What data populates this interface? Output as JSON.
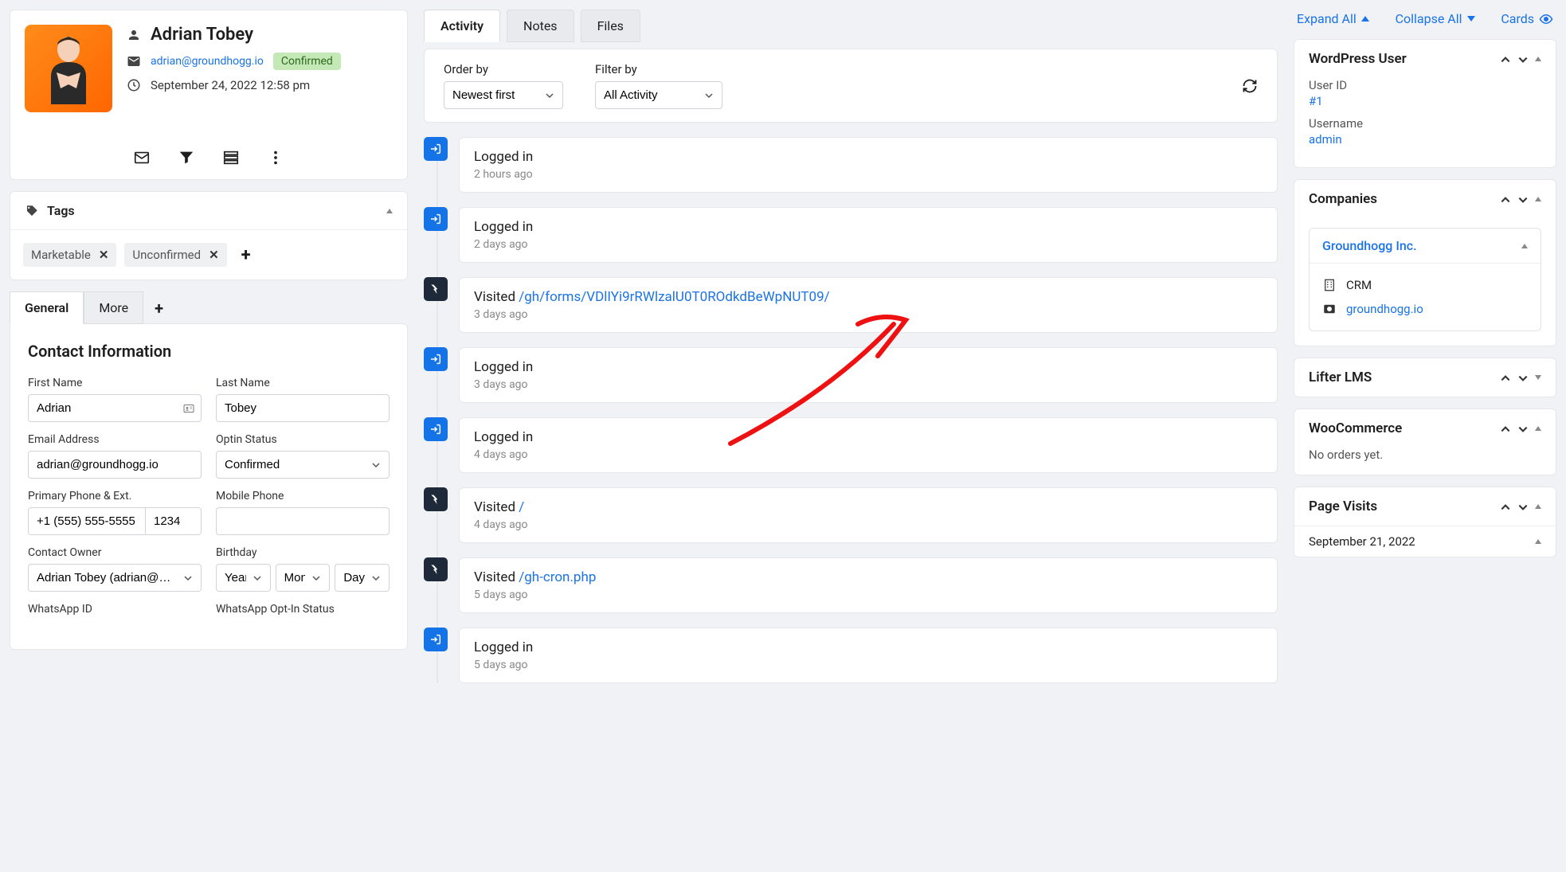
{
  "profile": {
    "name": "Adrian Tobey",
    "email": "adrian@groundhogg.io",
    "status": "Confirmed",
    "date": "September 24, 2022 12:58 pm"
  },
  "tags": {
    "title": "Tags",
    "items": [
      {
        "label": "Marketable"
      },
      {
        "label": "Unconfirmed"
      }
    ]
  },
  "detail_tabs": {
    "general": "General",
    "more": "More"
  },
  "contact_form": {
    "title": "Contact Information",
    "first_name": {
      "label": "First Name",
      "value": "Adrian"
    },
    "last_name": {
      "label": "Last Name",
      "value": "Tobey"
    },
    "email": {
      "label": "Email Address",
      "value": "adrian@groundhogg.io"
    },
    "optin": {
      "label": "Optin Status",
      "value": "Confirmed"
    },
    "phone": {
      "label": "Primary Phone & Ext.",
      "value": "+1 (555) 555-5555",
      "ext": "1234"
    },
    "mobile": {
      "label": "Mobile Phone",
      "value": ""
    },
    "owner": {
      "label": "Contact Owner",
      "value": "Adrian Tobey (adrian@groundhogg.io)"
    },
    "birthday": {
      "label": "Birthday",
      "year": "Year",
      "month": "Month",
      "day": "Day"
    },
    "whatsapp_id": {
      "label": "WhatsApp ID"
    },
    "whatsapp_optin": {
      "label": "WhatsApp Opt-In Status"
    }
  },
  "activity": {
    "tabs": {
      "activity": "Activity",
      "notes": "Notes",
      "files": "Files"
    },
    "order_by": {
      "label": "Order by",
      "value": "Newest first"
    },
    "filter_by": {
      "label": "Filter by",
      "value": "All Activity"
    },
    "items": [
      {
        "type": "login",
        "title": "Logged in",
        "time": "2 hours ago"
      },
      {
        "type": "login",
        "title": "Logged in",
        "time": "2 days ago"
      },
      {
        "type": "visit",
        "title_prefix": "Visited ",
        "link": "/gh/forms/VDlIYi9rRWlzalU0T0ROdkdBeWpNUT09/",
        "time": "3 days ago"
      },
      {
        "type": "login",
        "title": "Logged in",
        "time": "3 days ago"
      },
      {
        "type": "login",
        "title": "Logged in",
        "time": "4 days ago"
      },
      {
        "type": "visit",
        "title_prefix": "Visited ",
        "link": "/",
        "time": "4 days ago"
      },
      {
        "type": "visit",
        "title_prefix": "Visited ",
        "link": "/gh-cron.php",
        "time": "5 days ago"
      },
      {
        "type": "login",
        "title": "Logged in",
        "time": "5 days ago"
      }
    ]
  },
  "right": {
    "expand_all": "Expand All",
    "collapse_all": "Collapse All",
    "cards": "Cards",
    "wp_user": {
      "title": "WordPress User",
      "user_id_label": "User ID",
      "user_id": "#1",
      "username_label": "Username",
      "username": "admin"
    },
    "companies": {
      "title": "Companies",
      "item": {
        "name": "Groundhogg Inc.",
        "type": "CRM",
        "site": "groundhogg.io"
      }
    },
    "lifter": {
      "title": "Lifter LMS"
    },
    "woo": {
      "title": "WooCommerce",
      "empty": "No orders yet."
    },
    "page_visits": {
      "title": "Page Visits",
      "date": "September 21, 2022"
    }
  }
}
